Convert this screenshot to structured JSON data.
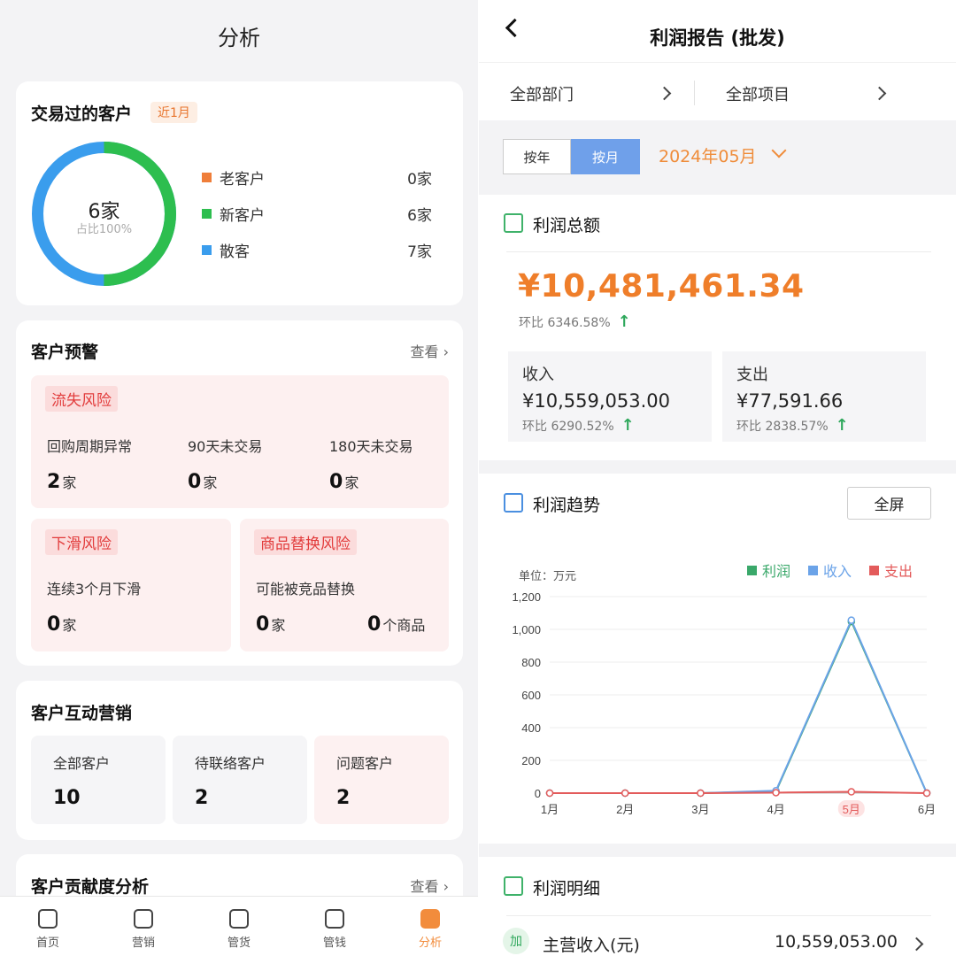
{
  "left": {
    "header_title": "分析",
    "customers_card": {
      "title": "交易过的客户",
      "period_tag": "近1月",
      "donut_center_value": "6家",
      "donut_center_sub": "占比100%",
      "donut_share_green": 0.5,
      "legend": [
        {
          "label": "老客户",
          "value": "0家",
          "color": "#ef7e3a"
        },
        {
          "label": "新客户",
          "value": "6家",
          "color": "#2dbe4f"
        },
        {
          "label": "散客",
          "value": "7家",
          "color": "#3a9ded"
        }
      ]
    },
    "warning_card": {
      "title": "客户预警",
      "more": "查看",
      "loss_risk": {
        "tag": "流失风险",
        "items": [
          {
            "label": "回购周期异常",
            "value": "2",
            "unit": "家"
          },
          {
            "label": "90天未交易",
            "value": "0",
            "unit": "家"
          },
          {
            "label": "180天未交易",
            "value": "0",
            "unit": "家"
          }
        ]
      },
      "decline_risk": {
        "tag": "下滑风险",
        "label": "连续3个月下滑",
        "value": "0",
        "unit": "家"
      },
      "replace_risk": {
        "tag": "商品替换风险",
        "label": "可能被竞品替换",
        "value1": "0",
        "unit1": "家",
        "value2": "0",
        "unit2": "个商品"
      }
    },
    "interaction_card": {
      "title": "客户互动营销",
      "items": [
        {
          "label": "全部客户",
          "value": "10"
        },
        {
          "label": "待联络客户",
          "value": "2"
        },
        {
          "label": "问题客户",
          "value": "2"
        }
      ]
    },
    "contribution_card": {
      "title": "客户贡献度分析",
      "more": "查看"
    },
    "bottom_nav": [
      {
        "label": "首页",
        "icon": "home-icon"
      },
      {
        "label": "营销",
        "icon": "marketing-icon"
      },
      {
        "label": "管货",
        "icon": "goods-icon"
      },
      {
        "label": "管钱",
        "icon": "wallet-icon"
      },
      {
        "label": "分析",
        "icon": "analysis-icon"
      }
    ]
  },
  "right": {
    "title": "利润报告 (批发)",
    "filters": {
      "department": "全部部门",
      "project": "全部项目"
    },
    "period": {
      "year_label": "按年",
      "month_label": "按月",
      "selected": "2024年05月"
    },
    "profit_total": {
      "title": "利润总额",
      "amount": "¥10,481,461.34",
      "ratio": "环比 6346.58%",
      "income": {
        "label": "收入",
        "value": "¥10,559,053.00",
        "ratio": "环比 6290.52%"
      },
      "expense": {
        "label": "支出",
        "value": "¥77,591.66",
        "ratio": "环比 2838.57%"
      }
    },
    "trend": {
      "title": "利润趋势",
      "fullscreen": "全屏",
      "unit": "单位：万元",
      "highlight_month": "5月"
    },
    "detail": {
      "title": "利润明细",
      "badge": "加",
      "label": "主营收入(元)",
      "value": "10,559,053.00"
    }
  },
  "chart_data": {
    "type": "line",
    "categories": [
      "1月",
      "2月",
      "3月",
      "4月",
      "5月",
      "6月"
    ],
    "series": [
      {
        "name": "利润",
        "values": [
          0,
          0,
          0,
          10,
          1048,
          0
        ],
        "color": "#3aa86a"
      },
      {
        "name": "收入",
        "values": [
          0,
          0,
          0,
          15,
          1056,
          0
        ],
        "color": "#6ba3e8"
      },
      {
        "name": "支出",
        "values": [
          0,
          0,
          0,
          3,
          8,
          0
        ],
        "color": "#e35b5b"
      }
    ],
    "ylabel": "单位：万元",
    "yticks": [
      "0",
      "200",
      "400",
      "600",
      "800",
      "1,000",
      "1,200"
    ],
    "ylim": [
      0,
      1200
    ],
    "grid": true,
    "legend": "top-right"
  }
}
